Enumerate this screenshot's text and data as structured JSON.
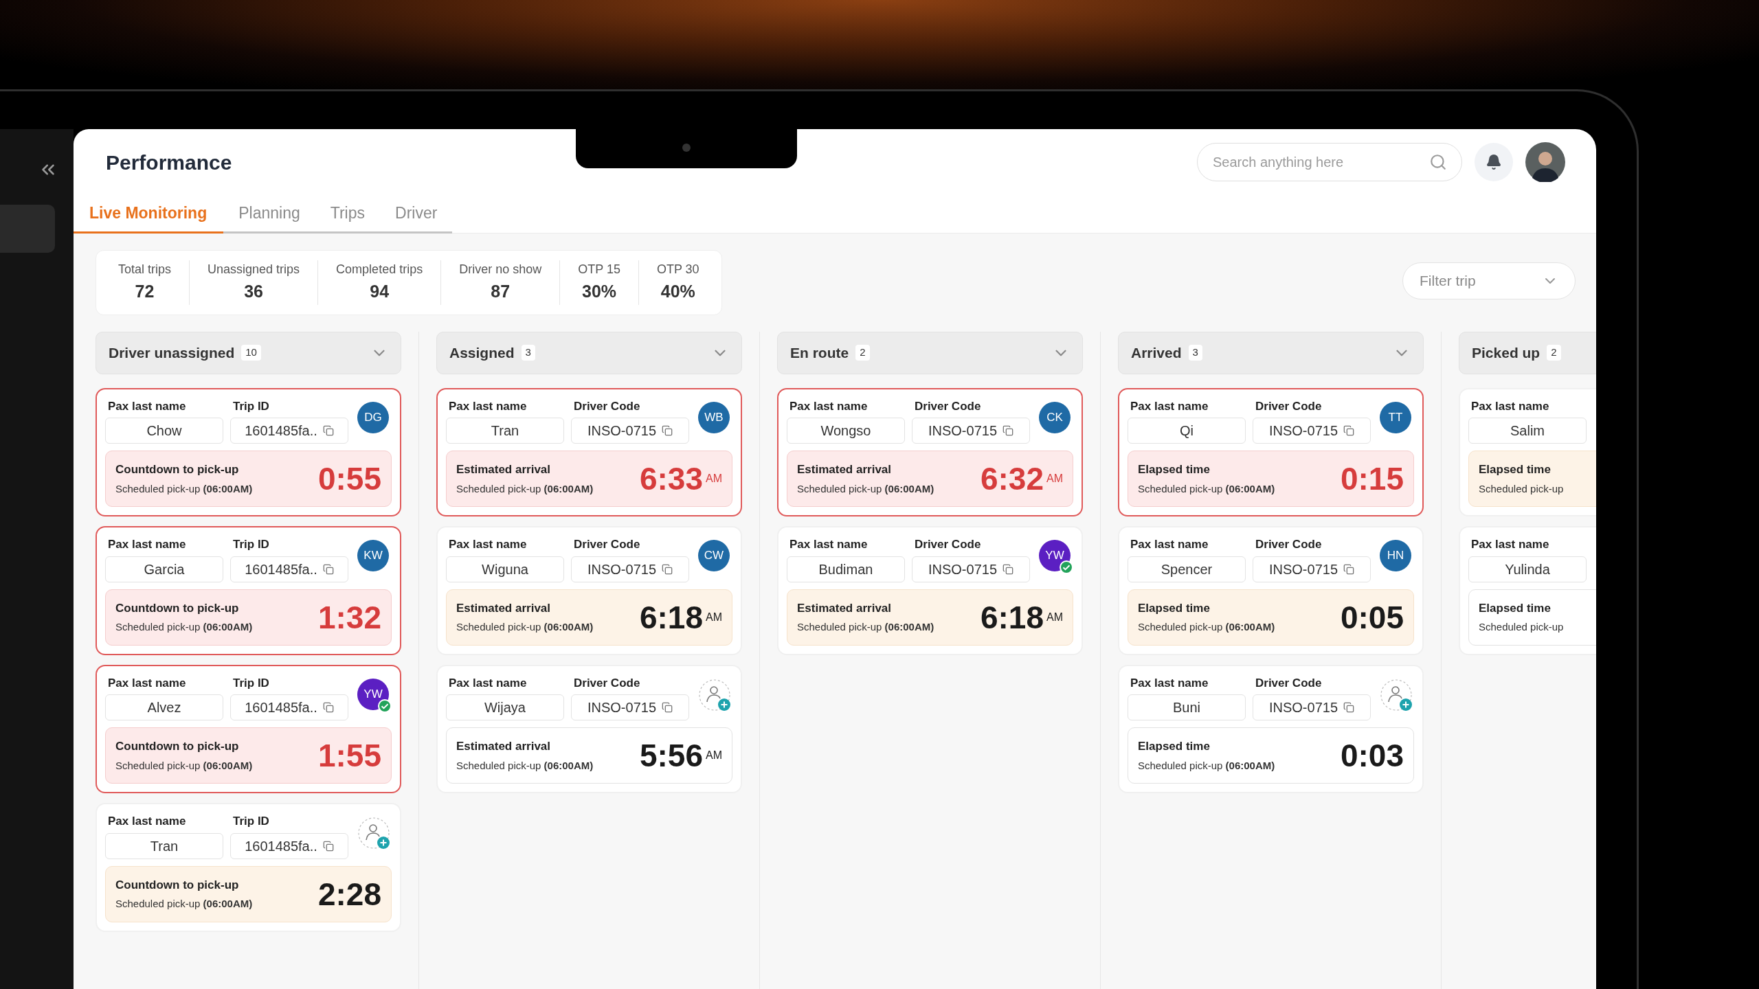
{
  "header": {
    "title": "Performance",
    "search": {
      "placeholder": "Search anything here"
    }
  },
  "tabs": [
    {
      "label": "Live Monitoring",
      "selected": true
    },
    {
      "label": "Planning",
      "selected": false
    },
    {
      "label": "Trips",
      "selected": false
    },
    {
      "label": "Driver",
      "selected": false
    }
  ],
  "stats": [
    {
      "label": "Total trips",
      "value": "72"
    },
    {
      "label": "Unassigned trips",
      "value": "36"
    },
    {
      "label": "Completed trips",
      "value": "94"
    },
    {
      "label": "Driver no show",
      "value": "87"
    },
    {
      "label": "OTP 15",
      "value": "30%"
    },
    {
      "label": "OTP 30",
      "value": "40%"
    }
  ],
  "filter": {
    "label": "Filter trip"
  },
  "columns": [
    {
      "title": "Driver unassigned",
      "count": "10",
      "has_menu": true,
      "cards": [
        {
          "alert": true,
          "pax_label": "Pax last name",
          "pax": "Chow",
          "code_label": "Trip ID",
          "code": "1601485fa..",
          "avatar": {
            "kind": "initials",
            "initials": "DG",
            "color": "#1f6aa5",
            "verified": false
          },
          "time_box": {
            "kind": "urgent",
            "label": "Countdown to pick-up",
            "schedule": "Scheduled pick-up **(06:00AM)**",
            "time": "0:55"
          }
        },
        {
          "alert": true,
          "pax_label": "Pax last name",
          "pax": "Garcia",
          "code_label": "Trip ID",
          "code": "1601485fa..",
          "avatar": {
            "kind": "initials",
            "initials": "KW",
            "color": "#1f6aa5",
            "verified": false
          },
          "time_box": {
            "kind": "urgent",
            "label": "Countdown to pick-up",
            "schedule": "Scheduled pick-up **(06:00AM)**",
            "time": "1:32"
          }
        },
        {
          "alert": true,
          "pax_label": "Pax last name",
          "pax": "Alvez",
          "code_label": "Trip ID",
          "code": "1601485fa..",
          "avatar": {
            "kind": "initials",
            "initials": "YW",
            "color": "#5b1fc2",
            "verified": true
          },
          "time_box": {
            "kind": "urgent",
            "label": "Countdown to pick-up",
            "schedule": "Scheduled pick-up **(06:00AM)**",
            "time": "1:55"
          }
        },
        {
          "alert": false,
          "pax_label": "Pax last name",
          "pax": "Tran",
          "code_label": "Trip ID",
          "code": "1601485fa..",
          "avatar": {
            "kind": "unassigned"
          },
          "time_box": {
            "kind": "warning",
            "label": "Countdown to pick-up",
            "schedule": "Scheduled pick-up **(06:00AM)**",
            "time": "2:28"
          }
        }
      ]
    },
    {
      "title": "Assigned",
      "count": "3",
      "has_menu": true,
      "cards": [
        {
          "alert": true,
          "pax_label": "Pax last name",
          "pax": "Tran",
          "code_label": "Driver Code",
          "code": "INSO-0715",
          "avatar": {
            "kind": "initials",
            "initials": "WB",
            "color": "#1f6aa5",
            "verified": false
          },
          "time_box": {
            "kind": "urgent",
            "label": "Estimated arrival",
            "schedule": "Scheduled pick-up **(06:00AM)**",
            "time": "6:33",
            "suffix": "AM"
          }
        },
        {
          "alert": false,
          "pax_label": "Pax last name",
          "pax": "Wiguna",
          "code_label": "Driver Code",
          "code": "INSO-0715",
          "avatar": {
            "kind": "initials",
            "initials": "CW",
            "color": "#1f6aa5",
            "verified": false
          },
          "time_box": {
            "kind": "warning",
            "label": "Estimated arrival",
            "schedule": "Scheduled pick-up **(06:00AM)**",
            "time": "6:18",
            "suffix": "AM"
          }
        },
        {
          "alert": false,
          "pax_label": "Pax last name",
          "pax": "Wijaya",
          "code_label": "Driver Code",
          "code": "INSO-0715",
          "avatar": {
            "kind": "unassigned"
          },
          "time_box": {
            "kind": "normal",
            "label": "Estimated arrival",
            "schedule": "Scheduled pick-up **(06:00AM)**",
            "time": "5:56",
            "suffix": "AM"
          }
        }
      ]
    },
    {
      "title": "En route",
      "count": "2",
      "has_menu": true,
      "cards": [
        {
          "alert": true,
          "pax_label": "Pax last name",
          "pax": "Wongso",
          "code_label": "Driver Code",
          "code": "INSO-0715",
          "avatar": {
            "kind": "initials",
            "initials": "CK",
            "color": "#1f6aa5",
            "verified": false
          },
          "time_box": {
            "kind": "urgent",
            "label": "Estimated arrival",
            "schedule": "Scheduled pick-up **(06:00AM)**",
            "time": "6:32",
            "suffix": "AM"
          }
        },
        {
          "alert": false,
          "pax_label": "Pax last name",
          "pax": "Budiman",
          "code_label": "Driver Code",
          "code": "INSO-0715",
          "avatar": {
            "kind": "initials",
            "initials": "YW",
            "color": "#5b1fc2",
            "verified": true
          },
          "time_box": {
            "kind": "warning",
            "label": "Estimated arrival",
            "schedule": "Scheduled pick-up **(06:00AM)**",
            "time": "6:18",
            "suffix": "AM"
          }
        }
      ]
    },
    {
      "title": "Arrived",
      "count": "3",
      "has_menu": true,
      "cards": [
        {
          "alert": true,
          "pax_label": "Pax last name",
          "pax": "Qi",
          "code_label": "Driver Code",
          "code": "INSO-0715",
          "avatar": {
            "kind": "initials",
            "initials": "TT",
            "color": "#1f6aa5",
            "verified": false
          },
          "time_box": {
            "kind": "urgent",
            "label": "Elapsed time",
            "schedule": "Scheduled pick-up **(06:00AM)**",
            "time": "0:15"
          }
        },
        {
          "alert": false,
          "pax_label": "Pax last name",
          "pax": "Spencer",
          "code_label": "Driver Code",
          "code": "INSO-0715",
          "avatar": {
            "kind": "initials",
            "initials": "HN",
            "color": "#1f6aa5",
            "verified": false
          },
          "time_box": {
            "kind": "warning",
            "label": "Elapsed time",
            "schedule": "Scheduled pick-up **(06:00AM)**",
            "time": "0:05"
          }
        },
        {
          "alert": false,
          "pax_label": "Pax last name",
          "pax": "Buni",
          "code_label": "Driver Code",
          "code": "INSO-0715",
          "avatar": {
            "kind": "unassigned"
          },
          "time_box": {
            "kind": "normal",
            "label": "Elapsed time",
            "schedule": "Scheduled pick-up **(06:00AM)**",
            "time": "0:03"
          }
        }
      ]
    },
    {
      "title": "Picked up",
      "count": "2",
      "cards": [
        {
          "alert": false,
          "pax_label": "Pax last name",
          "pax": "Salim",
          "time_box": {
            "kind": "warning",
            "label": "Elapsed time",
            "schedule": "Scheduled pick-up"
          }
        },
        {
          "alert": false,
          "pax_label": "Pax last name",
          "pax": "Yulinda",
          "time_box": {
            "kind": "normal",
            "label": "Elapsed time",
            "schedule": "Scheduled pick-up"
          }
        }
      ]
    }
  ]
}
